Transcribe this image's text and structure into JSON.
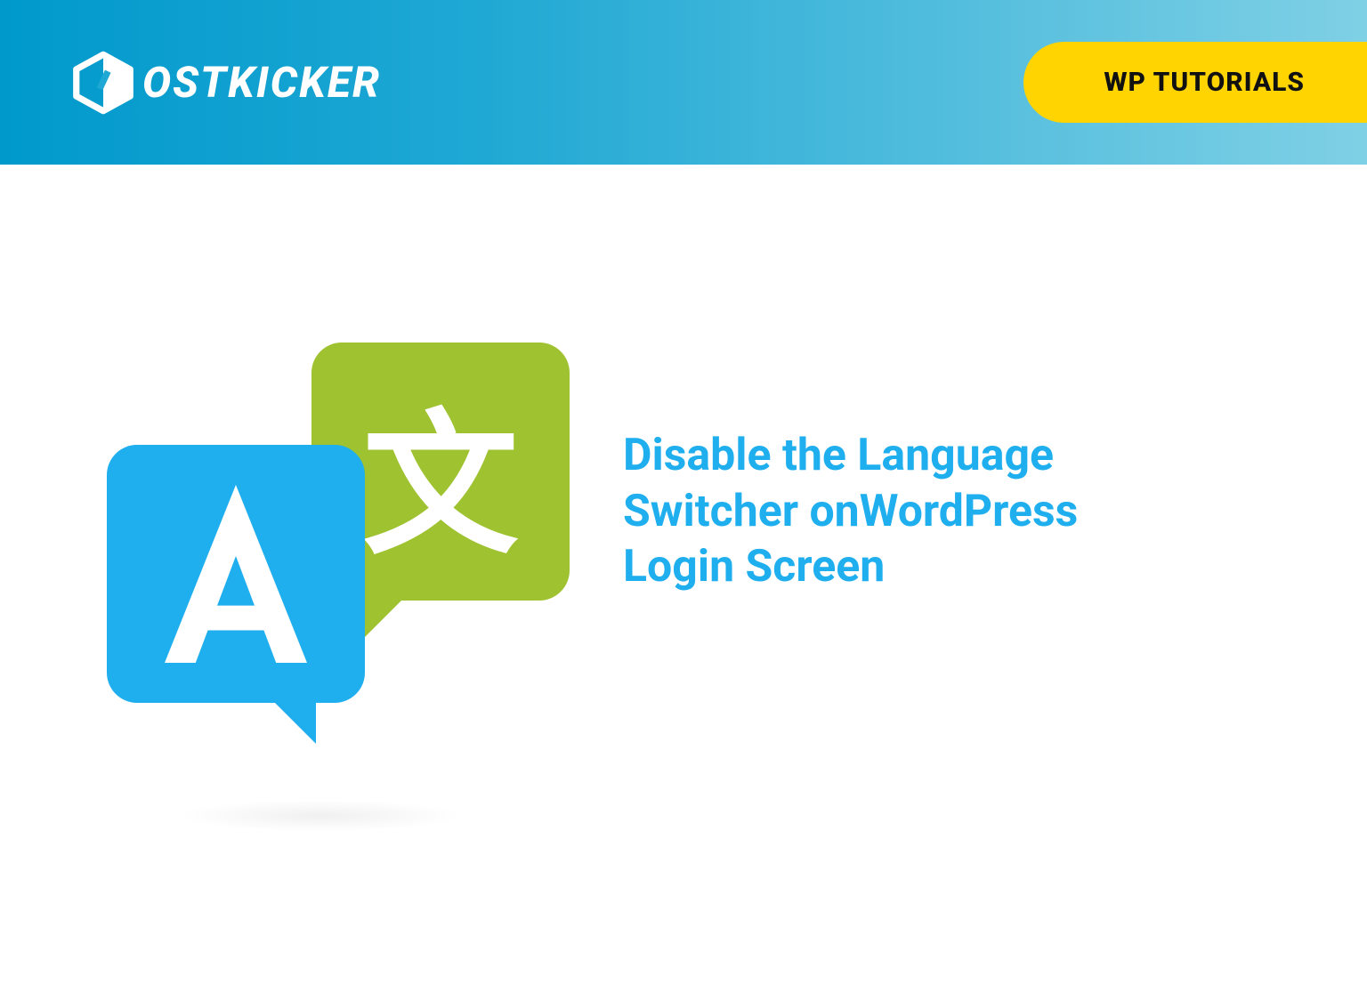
{
  "banner": {
    "logo_text": "OSTKICKER",
    "badge": "WP TUTORIALS"
  },
  "illustration": {
    "latin_glyph": "A",
    "cjk_glyph": "文"
  },
  "headline": "Disable the Language Switcher onWordPress Login Screen",
  "colors": {
    "banner_start": "#0099cc",
    "banner_end": "#7fd0e5",
    "badge_bg": "#ffd400",
    "bubble_blue": "#1faeee",
    "bubble_green": "#9fc231",
    "headline": "#1faeee"
  }
}
